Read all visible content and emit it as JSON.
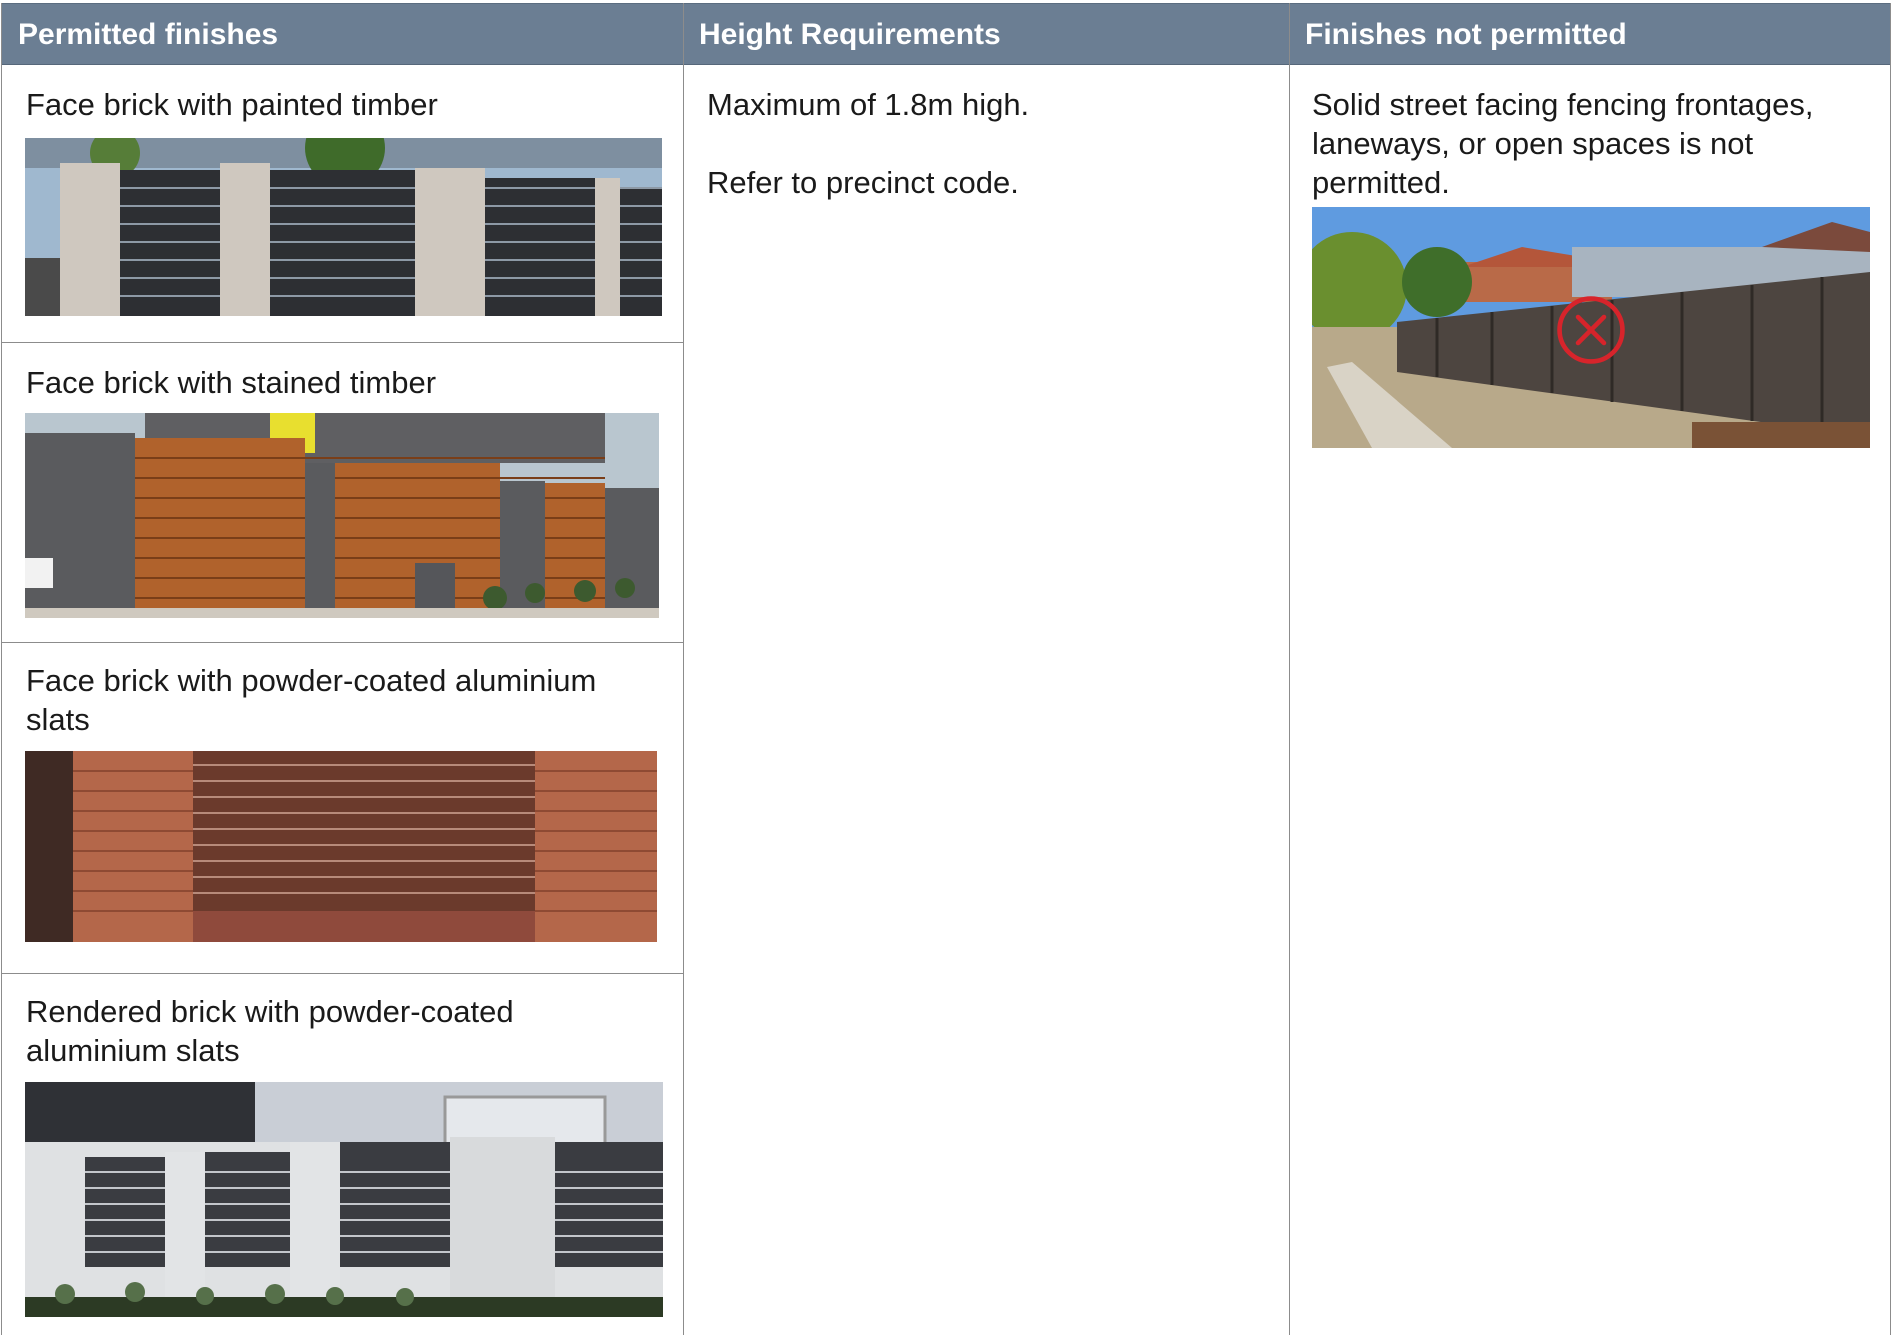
{
  "columns": {
    "permitted": {
      "header": "Permitted finishes"
    },
    "height": {
      "header": "Height Requirements"
    },
    "not_permitted": {
      "header": "Finishes not permitted"
    }
  },
  "permitted_items": [
    {
      "label": "Face brick with painted timber",
      "image": "fence-painted-timber-photo"
    },
    {
      "label": "Face brick with stained timber",
      "image": "fence-stained-timber-photo"
    },
    {
      "label": "Face brick with powder-coated aluminium slats",
      "image": "fence-brick-aluminium-slats-photo"
    },
    {
      "label": "Rendered brick with powder-coated aluminium slats",
      "image": "fence-rendered-aluminium-slats-photo"
    }
  ],
  "height_requirements": {
    "line1": "Maximum of 1.8m high.",
    "line2": "Refer to precinct code."
  },
  "not_permitted": {
    "text": "Solid street facing fencing frontages, laneways, or open spaces is not permitted.",
    "image": "solid-colorbond-fence-photo",
    "icon": "cross-circle-icon",
    "icon_color": "#d7242b"
  },
  "colors": {
    "header_bg": "#6b7e93",
    "header_text": "#ffffff",
    "border": "#8c8c8c"
  }
}
